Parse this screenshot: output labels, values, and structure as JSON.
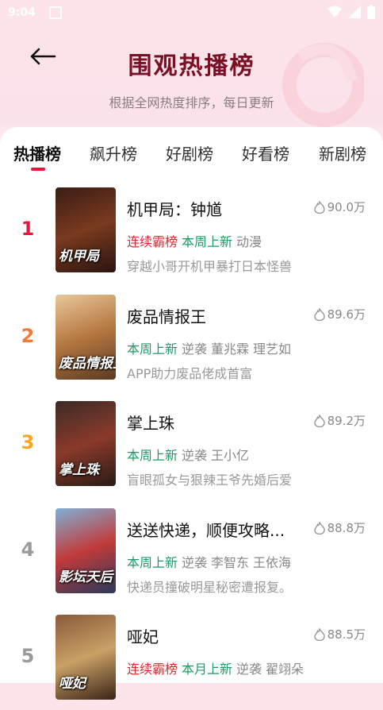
{
  "status_bar": {
    "time": "9:04"
  },
  "header": {
    "title": "围观热播榜",
    "subtitle": "根据全网热度排序，每日更新"
  },
  "tabs": [
    {
      "label": "热播榜",
      "active": true
    },
    {
      "label": "飙升榜",
      "active": false
    },
    {
      "label": "好剧榜",
      "active": false
    },
    {
      "label": "好看榜",
      "active": false
    },
    {
      "label": "新剧榜",
      "active": false
    }
  ],
  "items": [
    {
      "rank": "1",
      "rank_color": "#e8163a",
      "title": "机甲局：钟馗",
      "heat": "90.0万",
      "poster_text": "机甲局",
      "poster_colors": [
        "#3a1c16",
        "#7a3a1e",
        "#2a1410"
      ],
      "tags": [
        {
          "text": "连续霸榜",
          "type": "red"
        },
        {
          "text": "本周上新",
          "type": "green"
        },
        {
          "text": "动漫",
          "type": "gray"
        }
      ],
      "desc": "穿越小哥开机甲暴打日本怪兽"
    },
    {
      "rank": "2",
      "rank_color": "#f07a3a",
      "title": "废品情报王",
      "heat": "89.6万",
      "poster_text": "废品情报王",
      "poster_colors": [
        "#e9c89a",
        "#b57640",
        "#5a3a24"
      ],
      "tags": [
        {
          "text": "本周上新",
          "type": "green"
        },
        {
          "text": "逆袭",
          "type": "gray"
        },
        {
          "text": "董兆霖",
          "type": "gray"
        },
        {
          "text": "理艺如",
          "type": "gray"
        }
      ],
      "desc": "APP助力废品佬成首富"
    },
    {
      "rank": "3",
      "rank_color": "#f5a623",
      "title": "掌上珠",
      "heat": "89.2万",
      "poster_text": "掌上珠",
      "poster_colors": [
        "#3b2a26",
        "#8a3a2a",
        "#2a1a16"
      ],
      "tags": [
        {
          "text": "本周上新",
          "type": "green"
        },
        {
          "text": "逆袭",
          "type": "gray"
        },
        {
          "text": "王小亿",
          "type": "gray"
        }
      ],
      "desc": "盲眼孤女与狠辣王爷先婚后爱"
    },
    {
      "rank": "4",
      "rank_color": "#9a9a9a",
      "title": "送送快递，顺便攻略...",
      "heat": "88.8万",
      "poster_text": "影坛天后",
      "poster_colors": [
        "#7fb0d6",
        "#c23a3a",
        "#2a3a5a"
      ],
      "tags": [
        {
          "text": "本周上新",
          "type": "green"
        },
        {
          "text": "逆袭",
          "type": "gray"
        },
        {
          "text": "李智东",
          "type": "gray"
        },
        {
          "text": "王依海",
          "type": "gray"
        }
      ],
      "desc": "快递员撞破明星秘密遭报复。"
    },
    {
      "rank": "5",
      "rank_color": "#9a9a9a",
      "title": "哑妃",
      "heat": "88.5万",
      "poster_text": "哑妃",
      "poster_colors": [
        "#8a5a3a",
        "#c9a066",
        "#3a2418"
      ],
      "tags": [
        {
          "text": "连续霸榜",
          "type": "red"
        },
        {
          "text": "本月上新",
          "type": "green"
        },
        {
          "text": "逆袭",
          "type": "gray"
        },
        {
          "text": "翟翊朵",
          "type": "gray"
        }
      ],
      "desc": ""
    }
  ],
  "colors": {
    "accent": "#e8163a",
    "title": "#7a1024"
  }
}
